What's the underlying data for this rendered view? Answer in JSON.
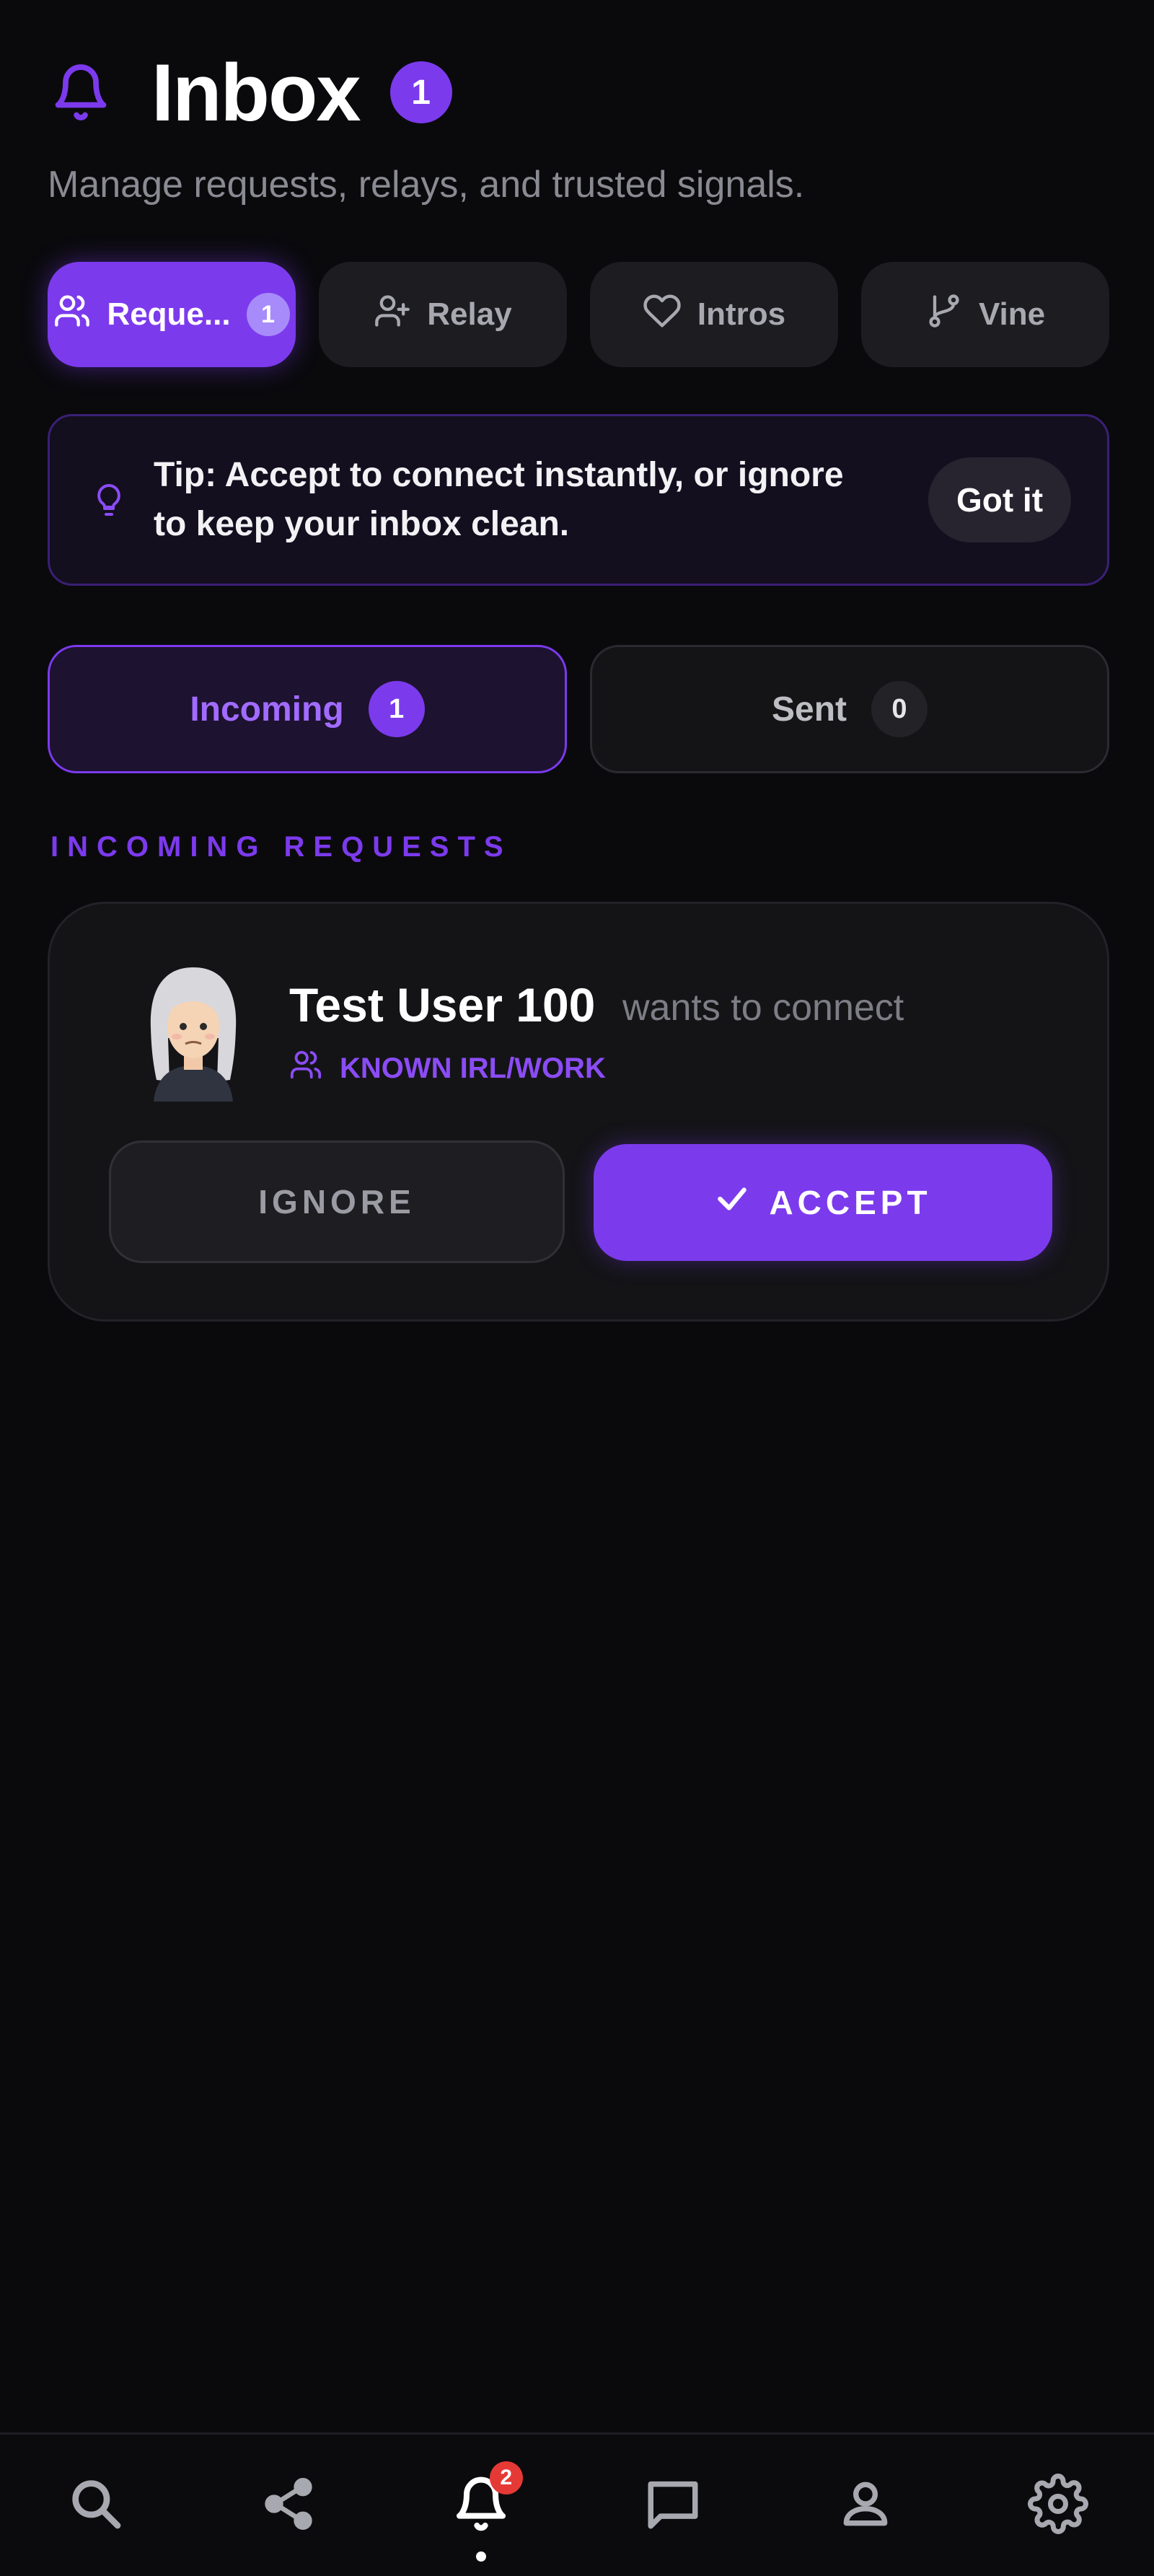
{
  "header": {
    "title": "Inbox",
    "badge": "1",
    "subtitle": "Manage requests, relays, and trusted signals."
  },
  "tabs": [
    {
      "label": "Reque...",
      "count": "1",
      "icon": "people-icon",
      "active": true
    },
    {
      "label": "Relay",
      "icon": "user-plus-icon",
      "active": false
    },
    {
      "label": "Intros",
      "icon": "heart-icon",
      "active": false
    },
    {
      "label": "Vine",
      "icon": "branch-icon",
      "active": false
    }
  ],
  "tip": {
    "text": "Tip: Accept to connect instantly, or ignore to keep your inbox clean.",
    "button": "Got it"
  },
  "segments": {
    "incoming": {
      "label": "Incoming",
      "count": "1"
    },
    "sent": {
      "label": "Sent",
      "count": "0"
    }
  },
  "section_label": "INCOMING REQUESTS",
  "request": {
    "name": "Test User 100",
    "action": "wants to connect",
    "relation": "KNOWN IRL/WORK",
    "ignore": "IGNORE",
    "accept": "ACCEPT"
  },
  "bottom_nav": {
    "items": [
      "search-icon",
      "share-icon",
      "bell-icon",
      "chat-icon",
      "person-icon",
      "gear-icon"
    ],
    "notification_badge": "2"
  },
  "colors": {
    "accent": "#7c3aed",
    "background": "#0a0a0d",
    "badge_red": "#e53935"
  }
}
